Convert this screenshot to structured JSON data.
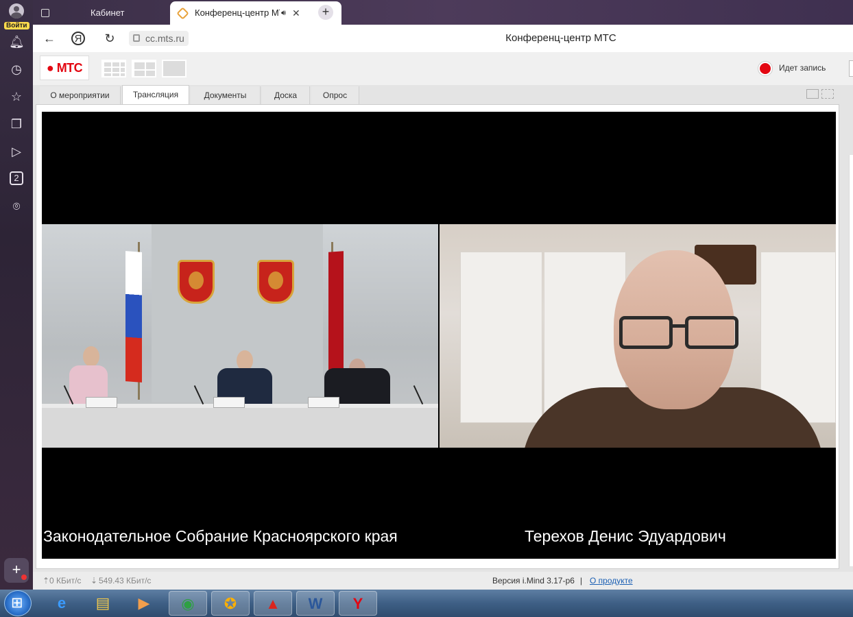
{
  "browser": {
    "sidebar_login_label": "Войти",
    "tabs": [
      {
        "label": "Кабинет",
        "active": false
      },
      {
        "label": "Конференц-центр МТС",
        "active": true
      }
    ],
    "address": "cc.mts.ru",
    "page_title": "Конференц-центр МТС"
  },
  "app": {
    "logo_text": "МТС",
    "recording_label": "Идет запись",
    "tabs": [
      {
        "label": "О мероприятии"
      },
      {
        "label": "Трансляция"
      },
      {
        "label": "Документы"
      },
      {
        "label": "Доска"
      },
      {
        "label": "Опрос"
      }
    ],
    "video": {
      "left_caption": "Законодательное Собрание Красноярского края",
      "right_caption": "Терехов Денис Эдуардович"
    },
    "status": {
      "upload": "0 КБит/с",
      "download": "549.43 КБит/с",
      "version": "Версия i.Mind 3.17-p6",
      "separator": "|",
      "about_link": "О продукте"
    }
  },
  "colors": {
    "mts_red": "#e30611",
    "recording_red": "#e30611",
    "link_blue": "#1a5fb4"
  },
  "icons": {
    "sidebar": [
      "bell-icon",
      "clock-icon",
      "star-icon",
      "collections-icon",
      "video-play-icon",
      "tabs-count-icon",
      "camera-icon"
    ],
    "taskbar": [
      "internet-explorer-icon",
      "file-explorer-icon",
      "media-player-icon",
      "chrome-icon",
      "people-icon",
      "pdf-reader-icon",
      "word-icon",
      "yandex-browser-icon"
    ]
  },
  "sidebar_tabs_count": "2"
}
